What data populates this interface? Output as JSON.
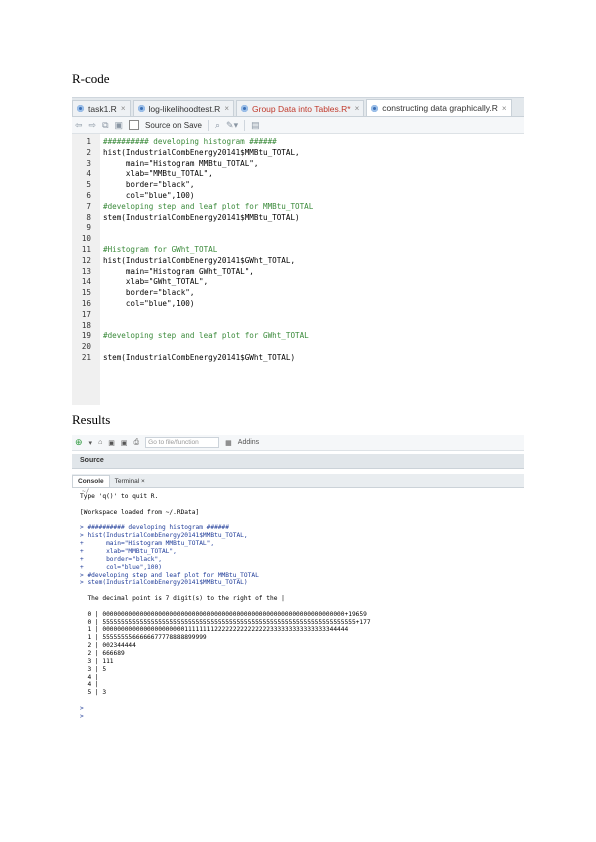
{
  "headings": {
    "rcode": "R-code",
    "results": "Results"
  },
  "editor": {
    "tabs": [
      {
        "label": "task1.R",
        "active": false,
        "modified": false
      },
      {
        "label": "log-likelihoodtest.R",
        "active": false,
        "modified": false
      },
      {
        "label": "Group Data into Tables.R*",
        "active": false,
        "modified": true
      },
      {
        "label": "constructing data graphically.R",
        "active": true,
        "modified": false
      }
    ],
    "toolbar": {
      "source_on_save": "Source on Save"
    },
    "lines": [
      {
        "n": "1",
        "text": "########## developing histogram ######",
        "comment": true
      },
      {
        "n": "2",
        "text": "hist(IndustrialCombEnergy20141$MMBtu_TOTAL,",
        "comment": false
      },
      {
        "n": "3",
        "text": "     main=\"Histogram MMBtu_TOTAL\",",
        "comment": false
      },
      {
        "n": "4",
        "text": "     xlab=\"MMBtu_TOTAL\",",
        "comment": false
      },
      {
        "n": "5",
        "text": "     border=\"black\",",
        "comment": false
      },
      {
        "n": "6",
        "text": "     col=\"blue\",100)",
        "comment": false
      },
      {
        "n": "7",
        "text": "#developing step and leaf plot for MMBtu_TOTAL",
        "comment": true
      },
      {
        "n": "8",
        "text": "stem(IndustrialCombEnergy20141$MMBtu_TOTAL)",
        "comment": false
      },
      {
        "n": "9",
        "text": "",
        "comment": false
      },
      {
        "n": "10",
        "text": "",
        "comment": false
      },
      {
        "n": "11",
        "text": "#Histogram for GWht_TOTAL",
        "comment": true
      },
      {
        "n": "12",
        "text": "hist(IndustrialCombEnergy20141$GWht_TOTAL,",
        "comment": false
      },
      {
        "n": "13",
        "text": "     main=\"Histogram GWht_TOTAL\",",
        "comment": false
      },
      {
        "n": "14",
        "text": "     xlab=\"GWht_TOTAL\",",
        "comment": false
      },
      {
        "n": "15",
        "text": "     border=\"black\",",
        "comment": false
      },
      {
        "n": "16",
        "text": "     col=\"blue\",100)",
        "comment": false
      },
      {
        "n": "17",
        "text": "",
        "comment": false
      },
      {
        "n": "18",
        "text": "",
        "comment": false
      },
      {
        "n": "19",
        "text": "#developing step and leaf plot for GWht_TOTAL",
        "comment": true
      },
      {
        "n": "20",
        "text": "",
        "comment": false
      },
      {
        "n": "21",
        "text": "stem(IndustrialCombEnergy20141$GWht_TOTAL)",
        "comment": false
      }
    ]
  },
  "console": {
    "toolbar": {
      "goto": "Go to file/function",
      "addins": "Addins"
    },
    "pane_title": "Source",
    "tabs": [
      {
        "label": "Console",
        "active": true
      },
      {
        "label": "Terminal ×",
        "active": false
      }
    ],
    "path": "~/",
    "lines": [
      {
        "text": "Type 'q()' to quit R.",
        "cmd": false
      },
      {
        "text": "",
        "cmd": false
      },
      {
        "text": "[Workspace loaded from ~/.RData]",
        "cmd": false
      },
      {
        "text": "",
        "cmd": false
      },
      {
        "text": "> ########## developing histogram ######",
        "cmd": true
      },
      {
        "text": "> hist(IndustrialCombEnergy20141$MMBtu_TOTAL,",
        "cmd": true
      },
      {
        "text": "+      main=\"Histogram MMBtu_TOTAL\",",
        "cmd": true
      },
      {
        "text": "+      xlab=\"MMBtu_TOTAL\",",
        "cmd": true
      },
      {
        "text": "+      border=\"black\",",
        "cmd": true
      },
      {
        "text": "+      col=\"blue\",100)",
        "cmd": true
      },
      {
        "text": "> #developing step and leaf plot for MMBtu_TOTAL",
        "cmd": true
      },
      {
        "text": "> stem(IndustrialCombEnergy20141$MMBtu_TOTAL)",
        "cmd": true
      },
      {
        "text": "",
        "cmd": false
      },
      {
        "text": "  The decimal point is 7 digit(s) to the right of the |",
        "cmd": false
      },
      {
        "text": "",
        "cmd": false
      },
      {
        "text": "  0 | 00000000000000000000000000000000000000000000000000000000000000000+19659",
        "cmd": false
      },
      {
        "text": "  0 | 55555555555555555555555555555555555555555555555555555555555555555555+177",
        "cmd": false
      },
      {
        "text": "  1 | 000000000000000000000011111111222222222222222333333333333333344444",
        "cmd": false
      },
      {
        "text": "  1 | 5555555566666677778888899999",
        "cmd": false
      },
      {
        "text": "  2 | 002344444",
        "cmd": false
      },
      {
        "text": "  2 | 666689",
        "cmd": false
      },
      {
        "text": "  3 | 111",
        "cmd": false
      },
      {
        "text": "  3 | 5",
        "cmd": false
      },
      {
        "text": "  4 |",
        "cmd": false
      },
      {
        "text": "  4 |",
        "cmd": false
      },
      {
        "text": "  5 | 3",
        "cmd": false
      },
      {
        "text": "",
        "cmd": false
      },
      {
        "text": ">",
        "cmd": true
      },
      {
        "text": ">",
        "cmd": true
      }
    ]
  }
}
